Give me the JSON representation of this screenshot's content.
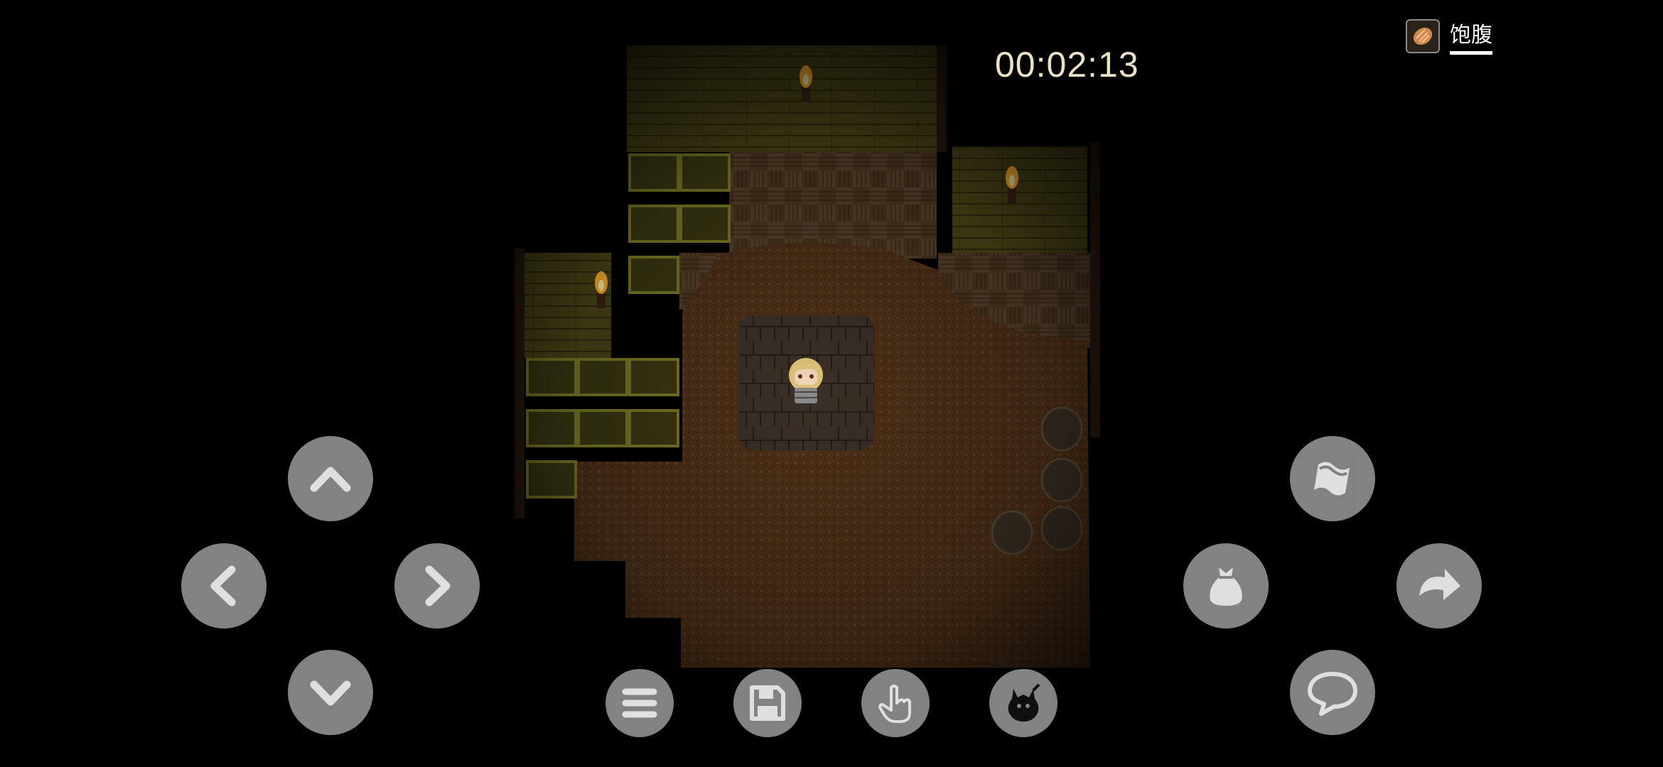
{
  "hud": {
    "timer": "00:02:13",
    "status_label": "饱腹",
    "status_icon": "bread-icon"
  },
  "dpad": {
    "up_icon": "chevron-up-icon",
    "down_icon": "chevron-down-icon",
    "left_icon": "chevron-left-icon",
    "right_icon": "chevron-right-icon"
  },
  "actions": {
    "map_icon": "map-scroll-icon",
    "inventory_icon": "bag-icon",
    "skip_icon": "redo-arrow-icon",
    "talk_icon": "speech-bubble-icon"
  },
  "toolbar": {
    "menu_icon": "menu-icon",
    "save_icon": "save-icon",
    "interact_icon": "hand-pointer-icon",
    "monster_icon": "monster-icon"
  },
  "colors": {
    "button_fill": "#8e8e8e",
    "button_glyph": "#f2f2f2",
    "floor": "#5a3a1c",
    "wall": "#4b4418"
  }
}
